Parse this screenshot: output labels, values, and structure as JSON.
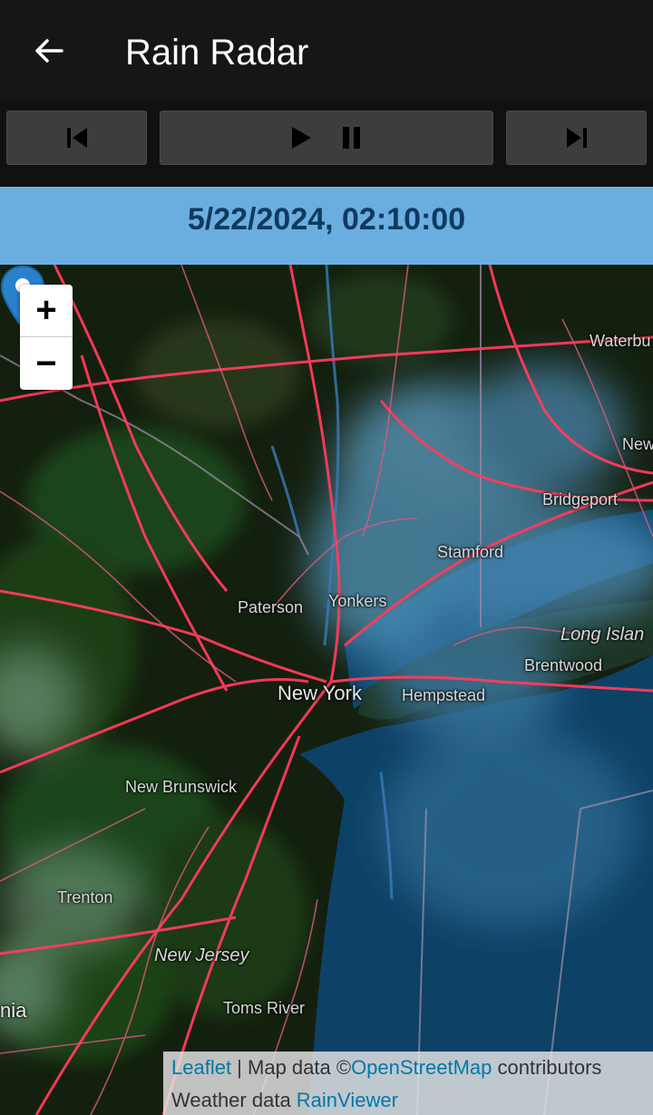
{
  "appbar": {
    "title": "Rain Radar"
  },
  "controls": {
    "prev_icon": "skip-previous-icon",
    "play_icon": "play-icon",
    "pause_icon": "pause-icon",
    "next_icon": "skip-next-icon"
  },
  "timestamp": "5/22/2024, 02:10:00",
  "map": {
    "zoom_in": "+",
    "zoom_out": "−",
    "labels": {
      "waterbury": "Waterbu",
      "new_haven": "New",
      "bridgeport": "Bridgeport",
      "stamford": "Stamford",
      "yonkers": "Yonkers",
      "paterson": "Paterson",
      "long_island": "Long Islan",
      "brentwood": "Brentwood",
      "new_york": "New York",
      "hempstead": "Hempstead",
      "new_brunswick": "New Brunswick",
      "trenton": "Trenton",
      "new_jersey": "New Jersey",
      "toms_river": "Toms River",
      "pennsylvania": "nia"
    }
  },
  "attribution": {
    "leaflet": "Leaflet",
    "sep": " | Map data ©",
    "osm": "OpenStreetMap",
    "contributors": " contributors",
    "weather_prefix": "Weather data ",
    "rainviewer": "RainViewer"
  },
  "colors": {
    "appbar": "#161616",
    "timebar": "#6aaee0",
    "land": "#142016",
    "ocean": "#0f3b5c",
    "roads": "#ff3b5c",
    "marker": "#2a81cb"
  }
}
